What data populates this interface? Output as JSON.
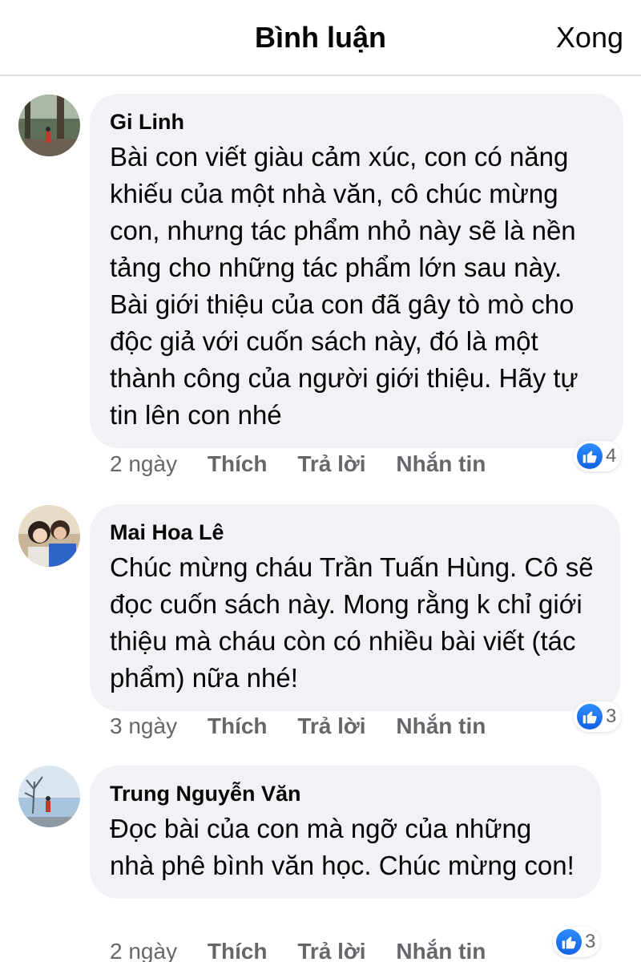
{
  "header": {
    "title": "Bình luận",
    "done_label": "Xong"
  },
  "comments": [
    {
      "author": "Gi Linh",
      "text": "Bài con viết giàu cảm xúc, con có năng khiếu của một nhà văn, cô chúc mừng con, nhưng tác phẩm nhỏ này sẽ là nền tảng cho những tác phẩm lớn sau này. Bài giới thiệu của con đã gây tò mò cho độc giả với cuốn sách này, đó là một thành công của người giới thiệu. Hãy tự tin lên con nhé",
      "time": "2 ngày",
      "like_label": "Thích",
      "reply_label": "Trả lời",
      "message_label": "Nhắn tin",
      "reaction_count": "4"
    },
    {
      "author": "Mai Hoa Lê",
      "text": "Chúc mừng cháu Trần Tuấn Hùng. Cô sẽ đọc cuốn sách này. Mong rằng k chỉ giới thiệu mà cháu còn có nhiều bài viết (tác phẩm) nữa nhé!",
      "time": "3 ngày",
      "like_label": "Thích",
      "reply_label": "Trả lời",
      "message_label": "Nhắn tin",
      "reaction_count": "3"
    },
    {
      "author": "Trung Nguyễn Văn",
      "text": "Đọc bài của con mà ngỡ của những nhà phê bình văn học. Chúc mừng con!",
      "time": "2 ngày",
      "like_label": "Thích",
      "reply_label": "Trả lời",
      "message_label": "Nhắn tin",
      "reaction_count": "3"
    }
  ],
  "colors": {
    "bubble": "#f0f2f5",
    "meta_text": "#65676b",
    "like_blue": "#1877f2"
  }
}
